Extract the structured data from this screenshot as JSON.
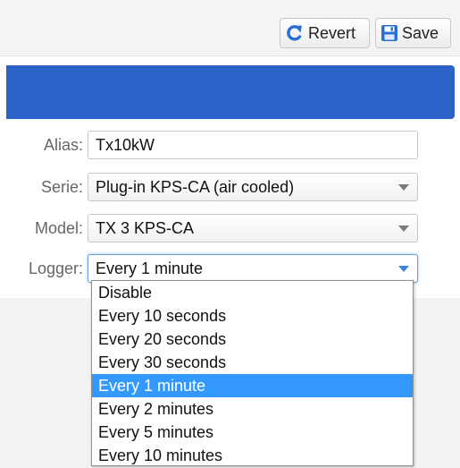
{
  "toolbar": {
    "revert_label": "Revert",
    "revert_icon": "revert-arrow-icon",
    "save_label": "Save",
    "save_icon": "floppy-disk-icon"
  },
  "form": {
    "alias": {
      "label": "Alias:",
      "value": "Tx10kW"
    },
    "serie": {
      "label": "Serie:",
      "value": "Plug-in KPS-CA (air cooled)"
    },
    "model": {
      "label": "Model:",
      "value": "TX 3 KPS-CA"
    },
    "logger": {
      "label": "Logger:",
      "value": "Every 1 minute",
      "options": [
        "Disable",
        "Every 10 seconds",
        "Every 20 seconds",
        "Every 30 seconds",
        "Every 1 minute",
        "Every 2 minutes",
        "Every 5 minutes",
        "Every 10 minutes"
      ],
      "selected_index": 4
    }
  },
  "colors": {
    "header_band": "#2d63c8",
    "option_highlight": "#3399ff",
    "icon_blue": "#2a6fd6"
  }
}
